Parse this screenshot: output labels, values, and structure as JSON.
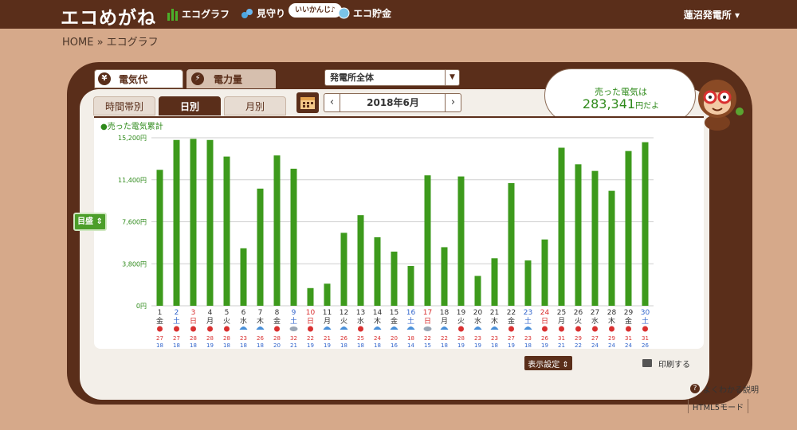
{
  "header": {
    "logo": "エコめがね",
    "nav": [
      {
        "label": "エコグラフ",
        "icon": "bar-chart-icon"
      },
      {
        "label": "見守り",
        "icon": "binoculars-icon"
      },
      {
        "label": "エコ貯金",
        "icon": "coin-icon"
      }
    ],
    "bubble": "いいかんじ♪",
    "plant": "蓮沼発電所 ▾"
  },
  "breadcrumb": "HOME » エコグラフ",
  "tabs": {
    "primary": [
      {
        "label": "電気代",
        "icon": "yen-icon",
        "active": true
      },
      {
        "label": "電力量",
        "icon": "lightning-icon",
        "active": false
      }
    ],
    "secondary": [
      {
        "label": "時間帯別",
        "active": false
      },
      {
        "label": "日別",
        "active": true
      },
      {
        "label": "月別",
        "active": false
      }
    ]
  },
  "plant_select": {
    "value": "発電所全体"
  },
  "date_nav": {
    "prev": "‹",
    "label": "2018年6月",
    "next": "›"
  },
  "speech": {
    "line1": "売った電気は",
    "amount": "283,341",
    "unit": "円だよ"
  },
  "side_toggle": "目盛 ⇕",
  "footer": {
    "display_settings": "表示設定 ⇕",
    "print": "印刷する",
    "help": "よくわかる説明",
    "html5": "HTML5モード"
  },
  "colors": {
    "bar": "#3d9a1c",
    "brown": "#5a2e1a",
    "sat": "#3366cc",
    "sun": "#d93030"
  },
  "chart_data": {
    "type": "bar",
    "legend": "●売った電気累計",
    "ylim": [
      0,
      15200
    ],
    "yticks": [
      "0円",
      "3,800円",
      "7,600円",
      "11,400円",
      "15,200円"
    ],
    "days": [
      "1",
      "2",
      "3",
      "4",
      "5",
      "6",
      "7",
      "8",
      "9",
      "10",
      "11",
      "12",
      "13",
      "14",
      "15",
      "16",
      "17",
      "18",
      "19",
      "20",
      "21",
      "22",
      "23",
      "24",
      "25",
      "26",
      "27",
      "28",
      "29",
      "30"
    ],
    "weekdays": [
      "金",
      "土",
      "日",
      "月",
      "火",
      "水",
      "木",
      "金",
      "土",
      "日",
      "月",
      "火",
      "水",
      "木",
      "金",
      "土",
      "日",
      "月",
      "火",
      "水",
      "木",
      "金",
      "土",
      "日",
      "月",
      "火",
      "水",
      "木",
      "金",
      "土"
    ],
    "values": [
      12300,
      15000,
      15100,
      15000,
      13500,
      5200,
      10600,
      13600,
      12400,
      1600,
      2000,
      6600,
      8200,
      6200,
      4900,
      3600,
      11800,
      5300,
      11700,
      2700,
      4300,
      11100,
      4100,
      6000,
      14300,
      12800,
      12200,
      10400,
      14000,
      14800
    ],
    "icons": [
      "sun",
      "sun",
      "sun",
      "sun",
      "sun",
      "umb",
      "umb",
      "sun",
      "cloud",
      "sun",
      "umb",
      "umb",
      "sun",
      "umb",
      "umb",
      "umb",
      "cloud",
      "umb",
      "sun",
      "umb",
      "umb",
      "sun",
      "umb",
      "sun",
      "sun",
      "sun",
      "sun",
      "sun",
      "sun",
      "sun"
    ],
    "high": [
      "27",
      "27",
      "28",
      "28",
      "28",
      "23",
      "26",
      "28",
      "32",
      "22",
      "21",
      "26",
      "25",
      "24",
      "20",
      "18",
      "22",
      "22",
      "28",
      "23",
      "23",
      "27",
      "23",
      "26",
      "31",
      "29",
      "27",
      "29",
      "31",
      "31"
    ],
    "low": [
      "18",
      "18",
      "18",
      "19",
      "18",
      "18",
      "18",
      "20",
      "21",
      "19",
      "19",
      "18",
      "18",
      "18",
      "16",
      "14",
      "15",
      "18",
      "19",
      "19",
      "18",
      "19",
      "18",
      "19",
      "21",
      "22",
      "24",
      "24",
      "24",
      "26"
    ]
  }
}
